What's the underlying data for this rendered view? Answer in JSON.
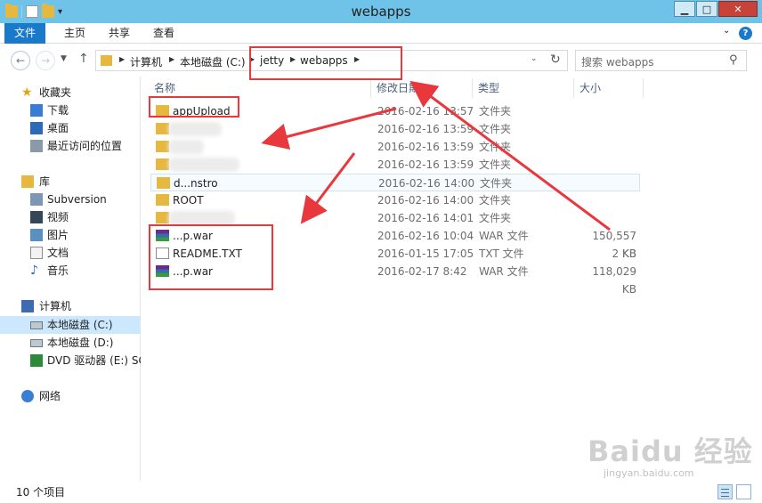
{
  "window": {
    "title": "webapps"
  },
  "ribbon": {
    "tabs": [
      "文件",
      "主页",
      "共享",
      "查看"
    ],
    "expand_icon": "chevron-down-icon",
    "help_label": "?"
  },
  "address": {
    "crumbs": [
      "计算机",
      "本地磁盘 (C:)",
      "jetty",
      "webapps"
    ],
    "search_placeholder": "搜索 webapps"
  },
  "sidebar": {
    "favorites": {
      "label": "收藏夹",
      "items": [
        "下载",
        "桌面",
        "最近访问的位置"
      ]
    },
    "libraries": {
      "label": "库",
      "items": [
        "Subversion",
        "视频",
        "图片",
        "文档",
        "音乐"
      ]
    },
    "computer": {
      "label": "计算机",
      "items": [
        "本地磁盘 (C:)",
        "本地磁盘 (D:)",
        "DVD 驱动器 (E:) SC"
      ]
    },
    "network": {
      "label": "网络"
    }
  },
  "columns": {
    "name": "名称",
    "date": "修改日期",
    "type": "类型",
    "size": "大小"
  },
  "files": [
    {
      "name": "appUpload",
      "date": "2016-02-16 13:57",
      "type": "文件夹",
      "size": "",
      "icon": "folder-icon"
    },
    {
      "name": "",
      "date": "2016-02-16 13:59",
      "type": "文件夹",
      "size": "",
      "icon": "folder-icon"
    },
    {
      "name": "",
      "date": "2016-02-16 13:59",
      "type": "文件夹",
      "size": "",
      "icon": "folder-icon"
    },
    {
      "name": "",
      "date": "2016-02-16 13:59",
      "type": "文件夹",
      "size": "",
      "icon": "folder-icon"
    },
    {
      "name": "d...nstro",
      "date": "2016-02-16 14:00",
      "type": "文件夹",
      "size": "",
      "icon": "folder-icon"
    },
    {
      "name": "ROOT",
      "date": "2016-02-16 14:00",
      "type": "文件夹",
      "size": "",
      "icon": "folder-icon"
    },
    {
      "name": "",
      "date": "2016-02-16 14:01",
      "type": "文件夹",
      "size": "",
      "icon": "folder-icon"
    },
    {
      "name": "...p.war",
      "date": "2016-02-16 10:04",
      "type": "WAR 文件",
      "size": "150,557 KB",
      "icon": "war-archive-icon"
    },
    {
      "name": "README.TXT",
      "date": "2016-01-15 17:05",
      "type": "TXT 文件",
      "size": "2 KB",
      "icon": "text-file-icon"
    },
    {
      "name": "...p.war",
      "date": "2016-02-17 8:42",
      "type": "WAR 文件",
      "size": "118,029 KB",
      "icon": "war-archive-icon"
    }
  ],
  "status": {
    "count_text": "10 个项目"
  },
  "watermark": {
    "text": "Baidu 经验",
    "sub": "jingyan.baidu.com"
  },
  "colors": {
    "titlebar": "#6fc3e8",
    "file_tab": "#1979ca",
    "annotation": "#e8383d",
    "selected": "#cce8ff"
  }
}
